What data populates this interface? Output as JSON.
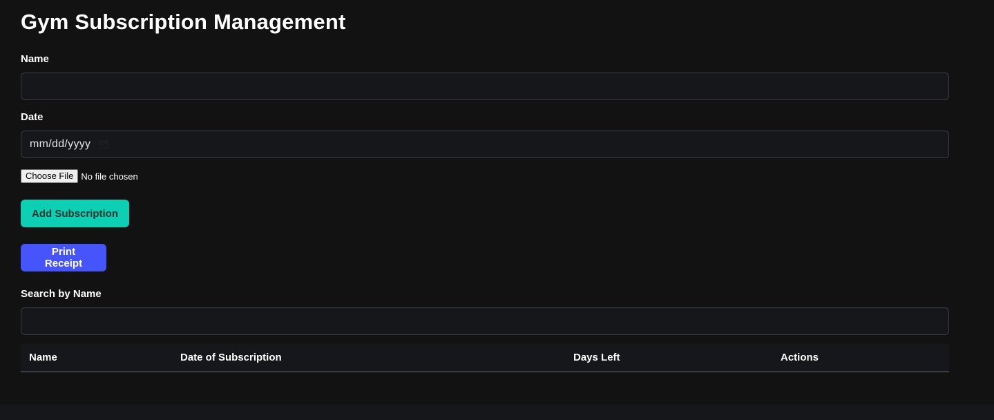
{
  "page": {
    "title": "Gym Subscription Management"
  },
  "form": {
    "name_label": "Name",
    "name_value": "",
    "date_label": "Date",
    "date_placeholder": "mm/dd/yyyy",
    "file_button_label": "Choose File",
    "file_status": "No file chosen",
    "add_button_label": "Add Subscription",
    "print_button_label": "Print Receipt"
  },
  "search": {
    "label": "Search by Name",
    "value": ""
  },
  "table": {
    "columns": [
      "Name",
      "Date of Subscription",
      "Days Left",
      "Actions"
    ],
    "rows": []
  },
  "colors": {
    "background": "#121212",
    "input_background": "#16171b",
    "add_button": "#0ccfb4",
    "print_button": "#4654fb"
  },
  "icons": {
    "date_picker": "calendar-icon"
  }
}
